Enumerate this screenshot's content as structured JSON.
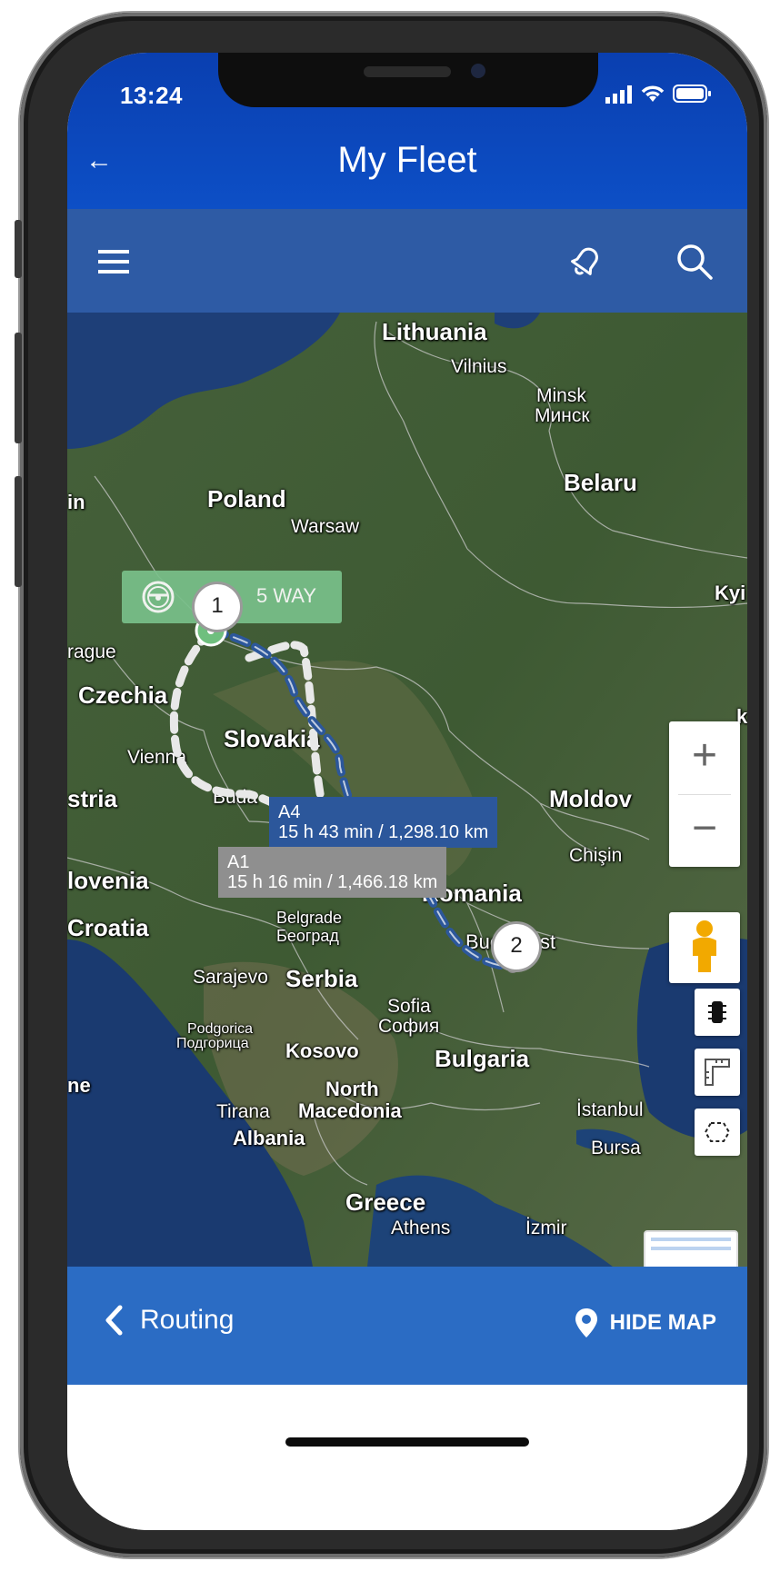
{
  "status_bar": {
    "time": "13:24"
  },
  "header": {
    "title": "My Fleet",
    "back_icon": "back-arrow-icon"
  },
  "toolbar": {
    "menu_icon": "hamburger-menu-icon",
    "alert_icon": "bell-icon",
    "search_icon": "search-icon"
  },
  "map": {
    "labels": {
      "lithuania": "Lithuania",
      "vilnius": "Vilnius",
      "minsk": "Minsk",
      "minsk_cyr": "Минск",
      "belarus": "Belaru",
      "poland": "Poland",
      "warsaw": "Warsaw",
      "prague": "rague",
      "czechia": "Czechia",
      "slovakia": "Slovakia",
      "vienna": "Vienna",
      "austria": "stria",
      "budapest": "Buda",
      "moldova": "Moldov",
      "chisinau": "Chişin",
      "slovenia": "lovenia",
      "croatia": "Croatia",
      "belgrade": "Belgrade",
      "belgrade_cyr": "Београд",
      "romania": "Romania",
      "bucharest": "Bucharest",
      "sarajevo": "Sarajevo",
      "serbia": "Serbia",
      "sofia": "Sofia",
      "sofia_cyr": "София",
      "podgorica": "Podgorica",
      "podgorica_cyr": "Подгорица",
      "kosovo": "Kosovo",
      "bulgaria": "Bulgaria",
      "north": "North",
      "macedonia": "Macedonia",
      "tirana": "Tirana",
      "albania": "Albania",
      "istanbul": "İstanbul",
      "bursa": "Bursa",
      "greece": "Greece",
      "athens": "Athens",
      "izmir": "İzmir",
      "kyiv": "Kyi",
      "edge_in": "in",
      "edge_ne": "ne",
      "edge_k": "k"
    },
    "driver_label": "5 WAY",
    "route_a4": {
      "name": "A4",
      "info": "15 h 43 min / 1,298.10 km",
      "color": "#2c579b"
    },
    "route_a1": {
      "name": "A1",
      "info": "15 h 16 min / 1,466.18 km",
      "color": "#8f8f8f"
    },
    "markers": {
      "start": "1",
      "end": "2"
    },
    "zoom_in": "+",
    "zoom_out": "−"
  },
  "bottom": {
    "routing_label": "Routing",
    "hide_map_label": "HIDE MAP"
  }
}
